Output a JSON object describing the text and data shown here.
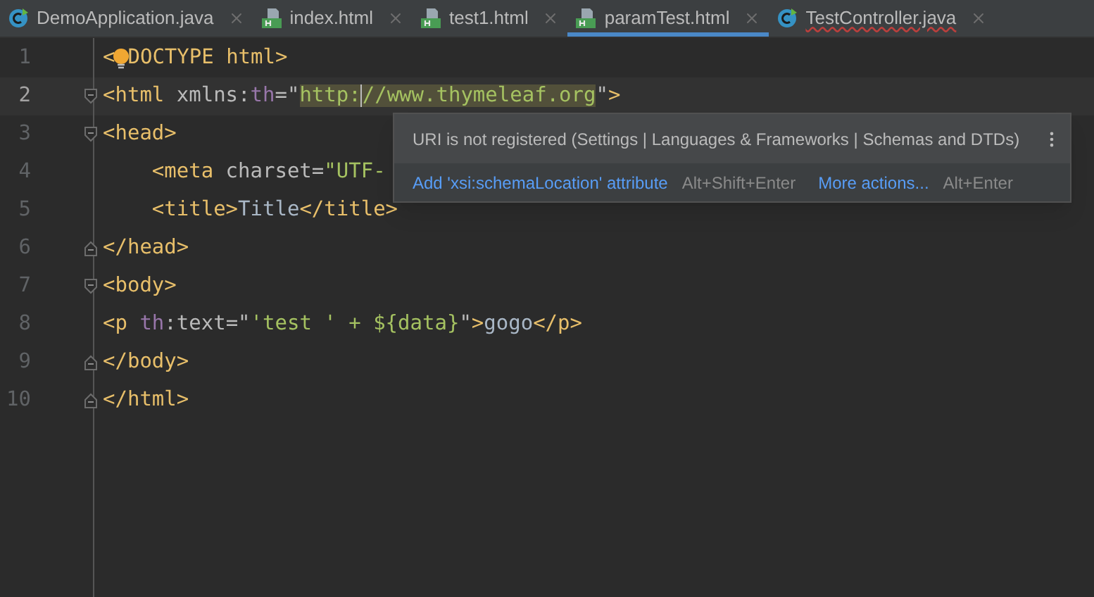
{
  "tabs": [
    {
      "label": "DemoApplication.java",
      "kind": "java",
      "selected": false,
      "error": false
    },
    {
      "label": "index.html",
      "kind": "html",
      "selected": false,
      "error": false
    },
    {
      "label": "test1.html",
      "kind": "html",
      "selected": false,
      "error": false
    },
    {
      "label": "paramTest.html",
      "kind": "html",
      "selected": true,
      "error": false
    },
    {
      "label": "TestController.java",
      "kind": "java",
      "selected": false,
      "error": true
    }
  ],
  "editor": {
    "lines": [
      {
        "number": "1",
        "current": false,
        "tokens": [
          {
            "kind": "tag",
            "text": "<"
          },
          {
            "kind": "bulb"
          },
          {
            "kind": "tag",
            "text": "DOCTYPE html>"
          }
        ]
      },
      {
        "number": "2",
        "current": true,
        "kind": "fold-start",
        "tokens": [
          {
            "kind": "tag",
            "text": "<html"
          },
          {
            "kind": "attr",
            "text": " xmlns:"
          },
          {
            "kind": "ns",
            "text": "th"
          },
          {
            "kind": "attr",
            "text": "=\""
          },
          {
            "kind": "string",
            "text": "http:",
            "highlighted": true
          },
          {
            "kind": "string",
            "text": "//www.thymeleaf.org",
            "highlighted": true,
            "caret_before": true
          },
          {
            "kind": "attr",
            "text": "\""
          },
          {
            "kind": "tag",
            "text": ">"
          }
        ]
      },
      {
        "number": "3",
        "current": false,
        "kind": "fold-start",
        "tokens": [
          {
            "kind": "tag",
            "text": "<head>"
          }
        ]
      },
      {
        "number": "4",
        "current": false,
        "tokens": [
          {
            "kind": "tag",
            "text": "    <meta"
          },
          {
            "kind": "attr",
            "text": " charset="
          },
          {
            "kind": "string",
            "text": "\"UTF-"
          }
        ]
      },
      {
        "number": "5",
        "current": false,
        "tokens": [
          {
            "kind": "tag",
            "text": "    <title>"
          },
          {
            "kind": "text",
            "text": "Title"
          },
          {
            "kind": "tag",
            "text": "</title>"
          }
        ]
      },
      {
        "number": "6",
        "current": false,
        "kind": "fold-end",
        "tokens": [
          {
            "kind": "tag",
            "text": "</head>"
          }
        ]
      },
      {
        "number": "7",
        "current": false,
        "kind": "fold-start",
        "tokens": [
          {
            "kind": "tag",
            "text": "<body>"
          }
        ]
      },
      {
        "number": "8",
        "current": false,
        "tokens": [
          {
            "kind": "tag",
            "text": "<p "
          },
          {
            "kind": "ns",
            "text": "th"
          },
          {
            "kind": "attr",
            "text": ":text=\""
          },
          {
            "kind": "string",
            "text": "'test ' + ${data}"
          },
          {
            "kind": "attr",
            "text": "\""
          },
          {
            "kind": "tag",
            "text": ">"
          },
          {
            "kind": "text",
            "text": "gogo"
          },
          {
            "kind": "tag",
            "text": "</p>"
          }
        ]
      },
      {
        "number": "9",
        "current": false,
        "kind": "fold-end",
        "tokens": [
          {
            "kind": "tag",
            "text": "</body>"
          }
        ]
      },
      {
        "number": "10",
        "current": false,
        "kind": "fold-end",
        "tokens": [
          {
            "kind": "tag",
            "text": "</html>"
          }
        ]
      }
    ]
  },
  "popup": {
    "message": "URI is not registered (Settings | Languages & Frameworks | Schemas and DTDs)",
    "actions": [
      {
        "label": "Add 'xsi:schemaLocation' attribute",
        "shortcut": "Alt+Shift+Enter"
      },
      {
        "label": "More actions...",
        "shortcut": "Alt+Enter"
      }
    ]
  }
}
